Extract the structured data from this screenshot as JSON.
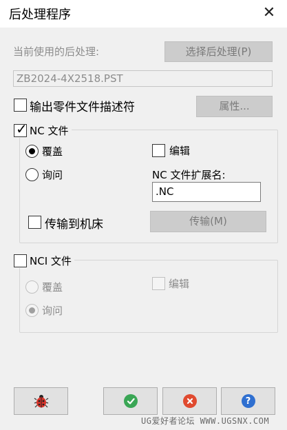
{
  "window": {
    "title": "后处理程序",
    "close_glyph": "✕"
  },
  "current_post": {
    "label": "当前使用的后处理:",
    "select_button": "选择后处理(P)",
    "value": "ZB2024-4X2518.PST"
  },
  "output_part_descriptor": {
    "label": "输出零件文件描述符",
    "checked": false,
    "properties_button": "属性..."
  },
  "nc_file": {
    "group_label": "NC 文件",
    "checked": true,
    "overwrite_label": "覆盖",
    "ask_label": "询问",
    "selected_option": "覆盖",
    "edit_label": "编辑",
    "edit_checked": false,
    "extension_label": "NC 文件扩展名:",
    "extension_value": ".NC",
    "transfer_to_machine_label": "传输到机床",
    "transfer_checked": false,
    "transfer_button": "传输(M)"
  },
  "nci_file": {
    "group_label": "NCI 文件",
    "checked": false,
    "overwrite_label": "覆盖",
    "ask_label": "询问",
    "selected_option": "询问",
    "edit_label": "编辑",
    "edit_checked": false
  },
  "footer": {
    "bug_icon": "ladybug-icon",
    "ok_icon": "checkmark-icon",
    "cancel_icon": "x-icon",
    "help_icon": "question-icon",
    "ok_color": "#3aa655",
    "cancel_color": "#e04a2f",
    "help_color": "#2f6fd0",
    "help_glyph": "?"
  },
  "watermark": "UG爱好者论坛 WWW.UGSNX.COM"
}
